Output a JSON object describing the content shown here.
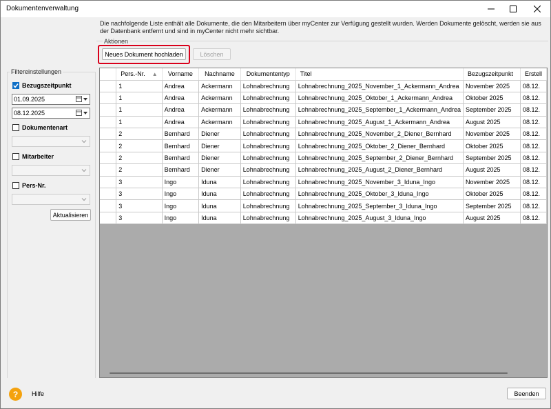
{
  "window": {
    "title": "Dokumentenverwaltung"
  },
  "info_text": "Die nachfolgende Liste enthält alle Dokumente, die den Mitarbeitern über myCenter zur Verfügung gestellt wurden. Werden Dokumente gelöscht, werden sie aus der Datenbank entfernt und sind in myCenter nicht mehr sichtbar.",
  "actions": {
    "legend": "Aktionen",
    "upload_label": "Neues  Dokument hochladen",
    "delete_label": "Löschen"
  },
  "filter": {
    "legend": "Filtereinstellungen",
    "bezugszeitpunkt": {
      "label": "Bezugszeitpunkt",
      "checked": true,
      "from": "01.09.2025",
      "to": "08.12.2025"
    },
    "dokumentenart": {
      "label": "Dokumentenart",
      "checked": false
    },
    "mitarbeiter": {
      "label": "Mitarbeiter",
      "checked": false
    },
    "persnr": {
      "label": "Pers-Nr.",
      "checked": false
    },
    "refresh_label": "Aktualisieren"
  },
  "grid": {
    "columns": [
      "Pers.-Nr.",
      "Vorname",
      "Nachname",
      "Dokumententyp",
      "Titel",
      "Bezugszeitpunkt",
      "Erstell"
    ],
    "rows": [
      [
        "1",
        "Andrea",
        "Ackermann",
        "Lohnabrechnung",
        "Lohnabrechnung_2025_November_1_Ackermann_Andrea",
        "November 2025",
        "08.12."
      ],
      [
        "1",
        "Andrea",
        "Ackermann",
        "Lohnabrechnung",
        "Lohnabrechnung_2025_Oktober_1_Ackermann_Andrea",
        "Oktober 2025",
        "08.12."
      ],
      [
        "1",
        "Andrea",
        "Ackermann",
        "Lohnabrechnung",
        "Lohnabrechnung_2025_September_1_Ackermann_Andrea",
        "September 2025",
        "08.12."
      ],
      [
        "1",
        "Andrea",
        "Ackermann",
        "Lohnabrechnung",
        "Lohnabrechnung_2025_August_1_Ackermann_Andrea",
        "August 2025",
        "08.12."
      ],
      [
        "2",
        "Bernhard",
        "Diener",
        "Lohnabrechnung",
        "Lohnabrechnung_2025_November_2_Diener_Bernhard",
        "November 2025",
        "08.12."
      ],
      [
        "2",
        "Bernhard",
        "Diener",
        "Lohnabrechnung",
        "Lohnabrechnung_2025_Oktober_2_Diener_Bernhard",
        "Oktober 2025",
        "08.12."
      ],
      [
        "2",
        "Bernhard",
        "Diener",
        "Lohnabrechnung",
        "Lohnabrechnung_2025_September_2_Diener_Bernhard",
        "September 2025",
        "08.12."
      ],
      [
        "2",
        "Bernhard",
        "Diener",
        "Lohnabrechnung",
        "Lohnabrechnung_2025_August_2_Diener_Bernhard",
        "August 2025",
        "08.12."
      ],
      [
        "3",
        "Ingo",
        "Iduna",
        "Lohnabrechnung",
        "Lohnabrechnung_2025_November_3_Iduna_Ingo",
        "November 2025",
        "08.12."
      ],
      [
        "3",
        "Ingo",
        "Iduna",
        "Lohnabrechnung",
        "Lohnabrechnung_2025_Oktober_3_Iduna_Ingo",
        "Oktober 2025",
        "08.12."
      ],
      [
        "3",
        "Ingo",
        "Iduna",
        "Lohnabrechnung",
        "Lohnabrechnung_2025_September_3_Iduna_Ingo",
        "September 2025",
        "08.12."
      ],
      [
        "3",
        "Ingo",
        "Iduna",
        "Lohnabrechnung",
        "Lohnabrechnung_2025_August_3_Iduna_Ingo",
        "August 2025",
        "08.12."
      ]
    ]
  },
  "footer": {
    "help_label": "Hilfe",
    "close_label": "Beenden"
  },
  "colors": {
    "highlight": "#d9001b",
    "checkbox_checked": "#0f6fc6",
    "grid_empty": "#ababab",
    "help_icon": "#f4a20e"
  },
  "icons": [
    "minimize-icon",
    "maximize-icon",
    "close-icon",
    "calendar-icon",
    "chevron-down-icon",
    "sort-ascending-icon",
    "help-icon",
    "check-icon"
  ]
}
